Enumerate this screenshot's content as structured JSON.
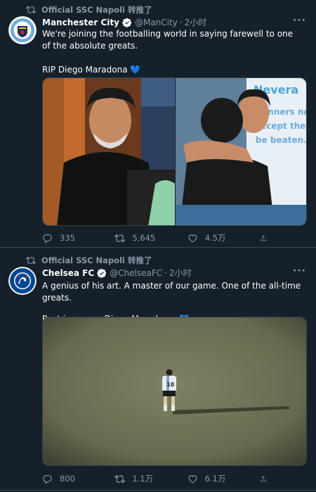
{
  "tweets": [
    {
      "retweeted_by": "Official SSC Napoli 转推了",
      "name": "Manchester City",
      "handle": "@ManCity",
      "time": "2小时",
      "text_line1": "We're joining the footballing world in saying farewell to one of the absolute greats.",
      "text_line2": "RIP Diego Maradona 💙",
      "replies": "335",
      "retweets": "5,645",
      "likes": "4.5万",
      "avatar_text": "MANCHESTER CITY"
    },
    {
      "retweeted_by": "Official SSC Napoli 转推了",
      "name": "Chelsea FC",
      "handle": "@ChelseaFC",
      "time": "2小时",
      "text_line1": "A genius of his art. A master of our game. One of the all-time greats.",
      "text_line2": "Rest in peace, Diego Maradona. 💙",
      "replies": "800",
      "retweets": "1.1万",
      "likes": "6.1万",
      "avatar_text": "CHELSEA FOOTBALL CLUB"
    }
  ],
  "banner_words": [
    "Nevera",
    "Winners ne",
    "accept they",
    "be beaten."
  ],
  "shirt_number": "10",
  "colors": {
    "background": "#15202b",
    "secondary_text": "#8899a6",
    "verified": "#1da1f2",
    "border": "#38444d"
  },
  "icons": [
    "retweet-icon",
    "verified-icon",
    "more-icon",
    "reply-icon",
    "like-icon",
    "share-icon"
  ]
}
